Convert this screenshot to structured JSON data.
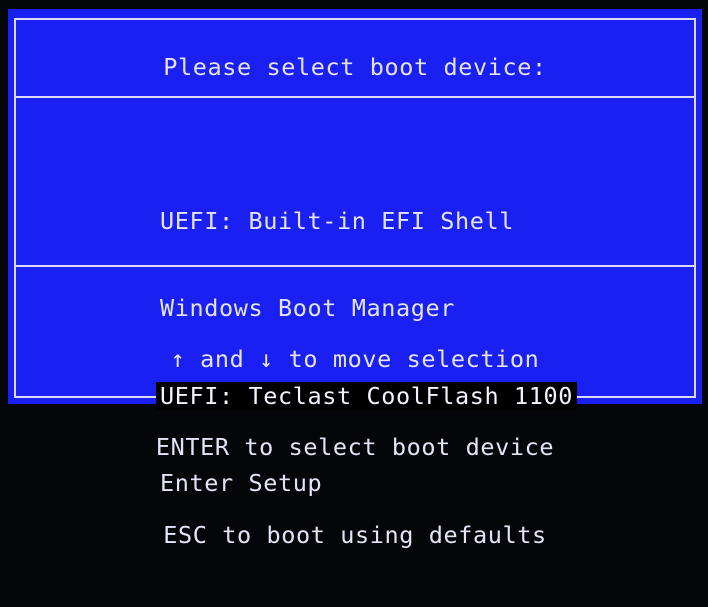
{
  "boot_menu": {
    "title": "Please select boot device:",
    "items": [
      {
        "label": "UEFI: Built-in EFI Shell",
        "selected": false
      },
      {
        "label": "Windows Boot Manager",
        "selected": false
      },
      {
        "label": "UEFI: Teclast CoolFlash 1100",
        "selected": true
      },
      {
        "label": "Enter Setup",
        "selected": false
      }
    ],
    "help": [
      "↑ and ↓ to move selection",
      "ENTER to select boot device",
      "ESC to boot using defaults"
    ]
  },
  "colors": {
    "background": "#1a1ff2",
    "text": "#e3e5f7",
    "highlight": "#000000"
  }
}
